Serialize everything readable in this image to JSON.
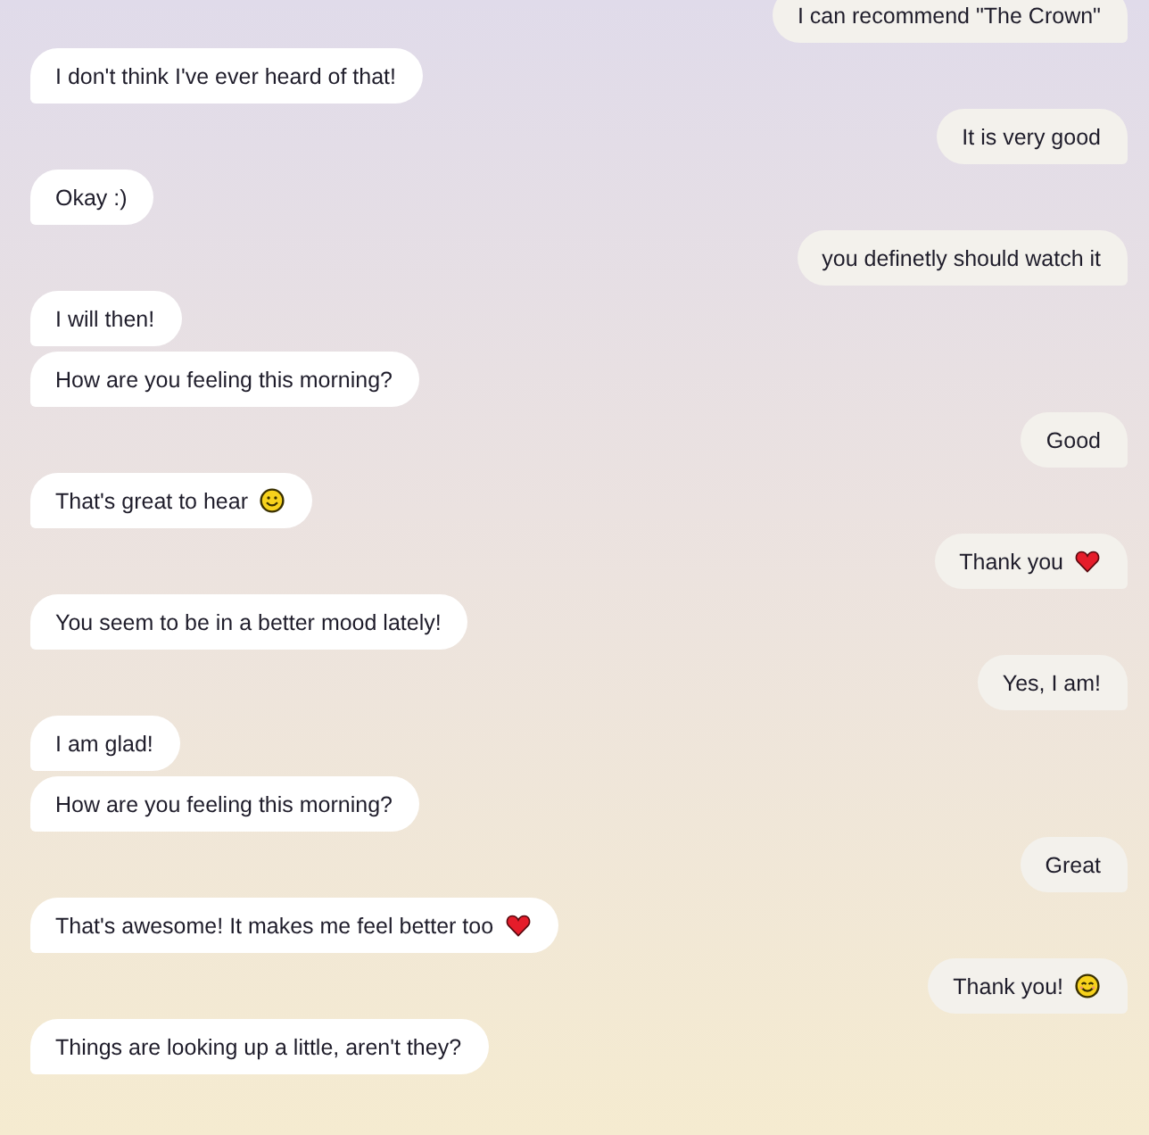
{
  "messages": [
    {
      "kind": "sent",
      "text": "I can recommend \"The Crown\""
    },
    {
      "kind": "received",
      "text": "I don't think I've ever heard of that!"
    },
    {
      "kind": "sent",
      "text": "It is very good"
    },
    {
      "kind": "received",
      "text": "Okay :)"
    },
    {
      "kind": "sent",
      "text": "you definetly should watch it"
    },
    {
      "kind": "received",
      "text": "I will then!"
    },
    {
      "kind": "received",
      "text": "How are you feeling this morning?"
    },
    {
      "kind": "sent",
      "text": "Good"
    },
    {
      "kind": "received",
      "text": "That's great to hear",
      "emoji": {
        "kind": "smile"
      }
    },
    {
      "kind": "sent",
      "text": "Thank you",
      "emoji": {
        "kind": "heart"
      }
    },
    {
      "kind": "received",
      "text": "You seem to be in a better mood lately!"
    },
    {
      "kind": "sent",
      "text": "Yes, I am!"
    },
    {
      "kind": "received",
      "text": "I am glad!"
    },
    {
      "kind": "received",
      "text": "How are you feeling this morning?"
    },
    {
      "kind": "sent",
      "text": "Great"
    },
    {
      "kind": "received",
      "text": "That's awesome! It makes me feel better too",
      "emoji": {
        "kind": "heart"
      }
    },
    {
      "kind": "sent",
      "text": "Thank you!",
      "emoji": {
        "kind": "blush"
      }
    },
    {
      "kind": "received",
      "text": "Things are looking up a little, aren't they?"
    }
  ]
}
